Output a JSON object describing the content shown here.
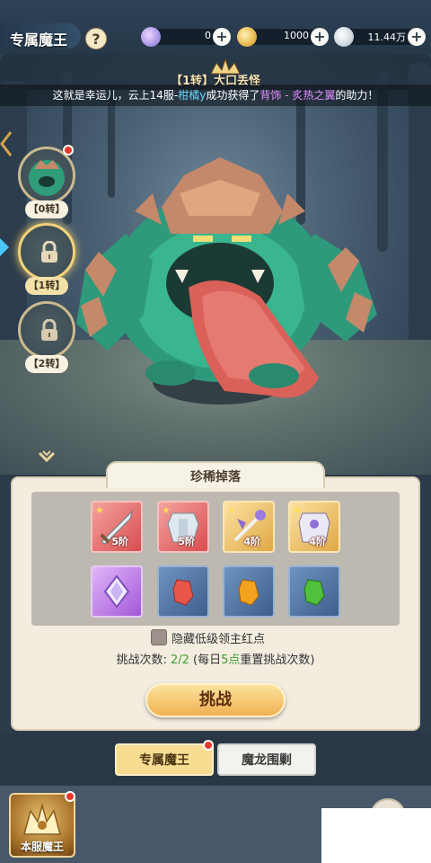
{
  "header": {
    "title": "专属魔王",
    "help": "?",
    "resources": [
      {
        "icon": "crystal-icon",
        "value": "0"
      },
      {
        "icon": "gold-leaf-icon",
        "value": "1000"
      },
      {
        "icon": "silver-leaf-icon",
        "value": "11.44万"
      }
    ],
    "plus": "+"
  },
  "boss": {
    "name": "【1转】大口丢怪"
  },
  "banner": {
    "prefix": "这就是幸运儿，云上14服-",
    "player": "柑橘y",
    "middle": "成功获得了",
    "item": "背饰 - 炙热之翼",
    "suffix": "的助力！"
  },
  "stages": [
    {
      "label": "【0转】",
      "locked": false,
      "active": false,
      "has_red_dot": true
    },
    {
      "label": "【1转】",
      "locked": true,
      "active": true,
      "has_red_dot": false
    },
    {
      "label": "【2转】",
      "locked": true,
      "active": false,
      "has_red_dot": false
    }
  ],
  "drops": {
    "title": "珍稀掉落",
    "items": [
      {
        "name": "sword-item",
        "rarity": "red",
        "tier": "5阶",
        "star": true
      },
      {
        "name": "armor-item",
        "rarity": "red",
        "tier": "5阶",
        "star": true
      },
      {
        "name": "staff-item",
        "rarity": "gold",
        "tier": "4阶",
        "star": true
      },
      {
        "name": "chestplate-item",
        "rarity": "gold",
        "tier": "4阶",
        "star": true
      },
      {
        "name": "purple-crystal-item",
        "rarity": "purple",
        "tier": "",
        "star": false
      },
      {
        "name": "red-shard-item",
        "rarity": "blue",
        "tier": "",
        "star": false
      },
      {
        "name": "orange-shard-item",
        "rarity": "blue",
        "tier": "",
        "star": false
      },
      {
        "name": "green-shard-item",
        "rarity": "blue",
        "tier": "",
        "star": false
      }
    ]
  },
  "hide_option": {
    "label": "隐藏低级领主红点",
    "checked": false
  },
  "attempts": {
    "prefix": "挑战次数: ",
    "current": "2/2",
    "mid": " (每日",
    "reset_time": "5点",
    "suffix": "重置挑战次数)"
  },
  "challenge_button": "挑战",
  "tabs": [
    {
      "label": "专属魔王",
      "active": true
    },
    {
      "label": "魔龙围剿",
      "active": false
    }
  ],
  "server_boss": {
    "label": "本服魔王"
  },
  "colors": {
    "accent_gold": "#f0b152",
    "panel": "#f3ede0",
    "red_dot": "#e5392b"
  }
}
